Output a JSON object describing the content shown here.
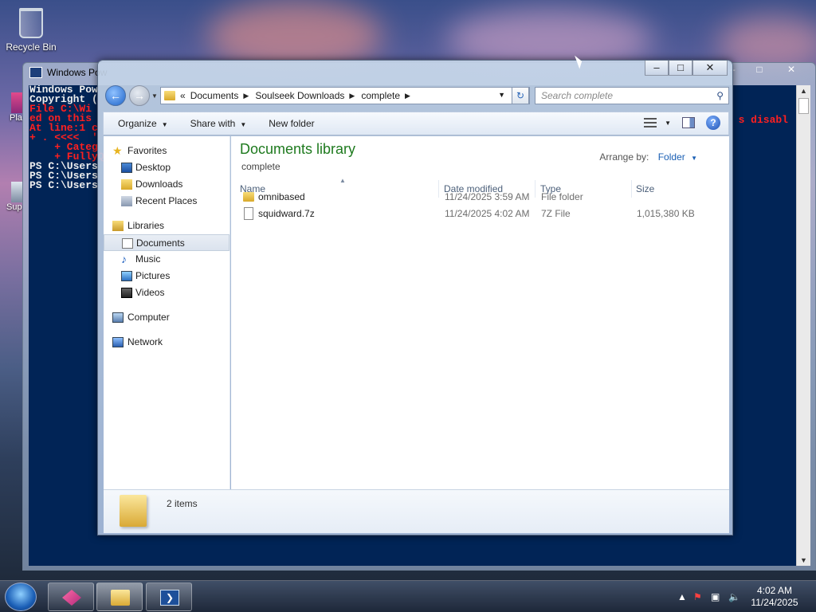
{
  "desktop": {
    "recycle_bin_label": "Recycle Bin",
    "side_icon_1_label": "Pla",
    "side_icon_2_label": "Sup"
  },
  "powershell": {
    "title": "Windows Pow",
    "lines": [
      {
        "text": "Windows Pow",
        "err": false
      },
      {
        "text": "Copyright (",
        "err": false
      },
      {
        "text": "",
        "err": false
      },
      {
        "text": "File C:\\Wi",
        "err": true
      },
      {
        "text": "ed on this",
        "err": true
      },
      {
        "text": "At line:1 c",
        "err": true
      },
      {
        "text": "+ . <<<<  '",
        "err": true
      },
      {
        "text": "    + Categ",
        "err": true
      },
      {
        "text": "    + FullyQ",
        "err": true
      },
      {
        "text": "",
        "err": false
      },
      {
        "text": "PS C:\\Users",
        "err": false
      },
      {
        "text": "PS C:\\Users",
        "err": false
      },
      {
        "text": "PS C:\\Users",
        "err": false
      }
    ],
    "err_right": "s disabl"
  },
  "explorer": {
    "address": {
      "overflow": "«",
      "segments": [
        "Documents",
        "Soulseek Downloads",
        "complete"
      ]
    },
    "search_placeholder": "Search complete",
    "toolbar": {
      "organize": "Organize",
      "share_with": "Share with",
      "new_folder": "New folder"
    },
    "nav": {
      "favorites": "Favorites",
      "desktop": "Desktop",
      "downloads": "Downloads",
      "recent_places": "Recent Places",
      "libraries": "Libraries",
      "documents": "Documents",
      "music": "Music",
      "pictures": "Pictures",
      "videos": "Videos",
      "computer": "Computer",
      "network": "Network"
    },
    "library": {
      "title": "Documents library",
      "subtitle": "complete",
      "arrange_label": "Arrange by:",
      "arrange_value": "Folder"
    },
    "columns": {
      "name": "Name",
      "date_modified": "Date modified",
      "type": "Type",
      "size": "Size"
    },
    "files": [
      {
        "name": "omnibased",
        "date": "11/24/2025 3:59 AM",
        "type": "File folder",
        "size": "",
        "kind": "folder"
      },
      {
        "name": "squidward.7z",
        "date": "11/24/2025 4:02 AM",
        "type": "7Z File",
        "size": "1,015,380 KB",
        "kind": "file"
      }
    ],
    "details": {
      "item_count": "2 items"
    }
  },
  "taskbar": {
    "time": "4:02 AM",
    "date": "11/24/2025"
  },
  "colors": {
    "library_title": "#1e7a1e",
    "powershell_bg": "#012456",
    "error_text": "#ff2020",
    "link_blue": "#1a5fb4"
  }
}
